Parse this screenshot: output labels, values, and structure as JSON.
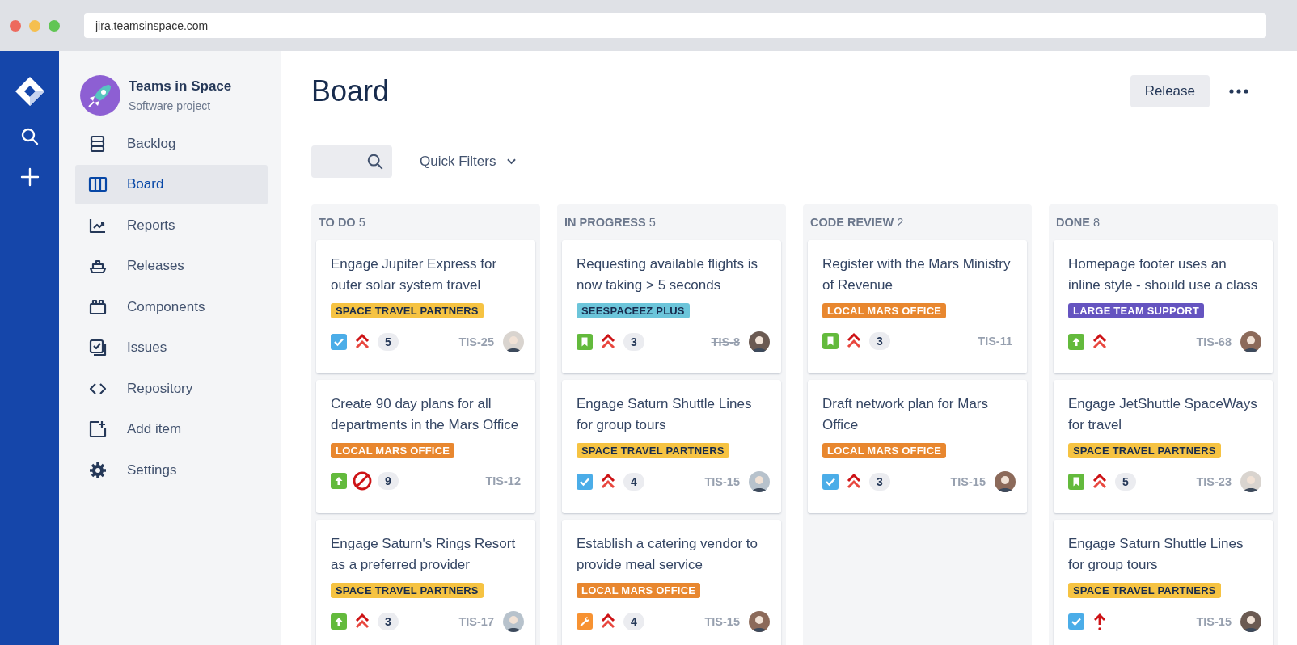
{
  "browser": {
    "url": "jira.teamsinspace.com"
  },
  "project": {
    "name": "Teams in Space",
    "type": "Software project"
  },
  "nav": [
    {
      "label": "Backlog",
      "selected": false
    },
    {
      "label": "Board",
      "selected": true
    },
    {
      "label": "Reports",
      "selected": false
    },
    {
      "label": "Releases",
      "selected": false
    },
    {
      "label": "Components",
      "selected": false
    },
    {
      "label": "Issues",
      "selected": false
    },
    {
      "label": "Repository",
      "selected": false
    },
    {
      "label": "Add item",
      "selected": false
    },
    {
      "label": "Settings",
      "selected": false
    }
  ],
  "header": {
    "title": "Board",
    "release_button": "Release"
  },
  "toolbar": {
    "quick_filters": "Quick Filters"
  },
  "columns": [
    {
      "name": "TO DO",
      "count": "5",
      "cards": [
        {
          "title": "Engage Jupiter Express for outer solar system travel",
          "label": {
            "text": "SPACE TRAVEL PARTNERS",
            "color": "#f6c342"
          },
          "kind": "task",
          "priority": {
            "kind": "highest"
          },
          "points": "5",
          "key": "TIS-25",
          "resolved": false,
          "assignee": true
        },
        {
          "title": "Create 90 day plans for all departments in the Mars Office",
          "label": {
            "text": "LOCAL MARS OFFICE",
            "color": "#e8872f"
          },
          "kind": "improvement",
          "priority": {
            "kind": "blocker"
          },
          "points": "9",
          "key": "TIS-12",
          "resolved": false,
          "assignee": false
        },
        {
          "title": "Engage Saturn's Rings Resort as a preferred provider",
          "label": {
            "text": "SPACE TRAVEL PARTNERS",
            "color": "#f6c342"
          },
          "kind": "improvement",
          "priority": {
            "kind": "highest"
          },
          "points": "3",
          "key": "TIS-17",
          "resolved": false,
          "assignee": true
        }
      ]
    },
    {
      "name": "IN PROGRESS",
      "count": "5",
      "cards": [
        {
          "title": "Requesting available flights is now taking > 5 seconds",
          "label": {
            "text": "SEESPACEEZ PLUS",
            "color": "#6cc5da"
          },
          "kind": "story",
          "priority": {
            "kind": "highest"
          },
          "points": "3",
          "key": "TIS-8",
          "resolved": true,
          "assignee": true
        },
        {
          "title": "Engage Saturn Shuttle Lines for group tours",
          "label": {
            "text": "SPACE TRAVEL PARTNERS",
            "color": "#f6c342"
          },
          "kind": "task",
          "priority": {
            "kind": "highest"
          },
          "points": "4",
          "key": "TIS-15",
          "resolved": false,
          "assignee": true
        },
        {
          "title": "Establish a catering vendor to provide meal service",
          "label": {
            "text": "LOCAL MARS OFFICE",
            "color": "#e8872f"
          },
          "kind": "maintenance",
          "priority": {
            "kind": "highest"
          },
          "points": "4",
          "key": "TIS-15",
          "resolved": false,
          "assignee": true
        }
      ]
    },
    {
      "name": "CODE REVIEW",
      "count": "2",
      "cards": [
        {
          "title": "Register with the Mars Ministry of Revenue",
          "label": {
            "text": "LOCAL MARS OFFICE",
            "color": "#e8872f"
          },
          "kind": "story",
          "priority": {
            "kind": "highest"
          },
          "points": "3",
          "key": "TIS-11",
          "resolved": false,
          "assignee": false
        },
        {
          "title": "Draft network plan for Mars Office",
          "label": {
            "text": "LOCAL MARS OFFICE",
            "color": "#e8872f"
          },
          "kind": "task",
          "priority": {
            "kind": "highest"
          },
          "points": "3",
          "key": "TIS-15",
          "resolved": false,
          "assignee": true
        }
      ]
    },
    {
      "name": "DONE",
      "count": "8",
      "cards": [
        {
          "title": "Homepage footer uses an inline style - should use a class",
          "label": {
            "text": "LARGE TEAM SUPPORT",
            "color": "#6554c0"
          },
          "kind": "improvement",
          "priority": {
            "kind": "highest"
          },
          "key": "TIS-68",
          "resolved": false,
          "assignee": true
        },
        {
          "title": "Engage JetShuttle SpaceWays for travel",
          "label": {
            "text": "SPACE TRAVEL PARTNERS",
            "color": "#f6c342"
          },
          "kind": "story",
          "priority": {
            "kind": "highest"
          },
          "points": "5",
          "key": "TIS-23",
          "resolved": false,
          "assignee": true
        },
        {
          "title": "Engage Saturn Shuttle Lines for group tours",
          "label": {
            "text": "SPACE TRAVEL PARTNERS",
            "color": "#f6c342"
          },
          "kind": "task",
          "priority": {
            "kind": "high"
          },
          "key": "TIS-15",
          "resolved": false,
          "assignee": true
        }
      ]
    }
  ]
}
